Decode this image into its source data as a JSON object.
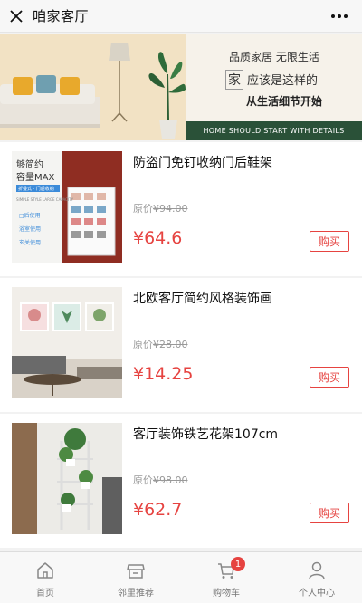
{
  "header": {
    "title": "咱家客厅",
    "close_icon": "close-icon",
    "more_icon": "more-icon"
  },
  "banner": {
    "line1": "品质家居 无限生活",
    "line2_box": "家",
    "line2_rest": "应该是这样的",
    "line3": "从生活细节开始",
    "strip": "HOME SHOULD START WITH DETAILS"
  },
  "products": [
    {
      "name": "防盗门免钉收纳门后鞋架",
      "orig_label": "原价",
      "orig_price": "¥94.00",
      "price": "¥64.6",
      "buy": "购买",
      "thumb_text": {
        "t1": "够简约",
        "t2": "容量MAX",
        "t3": "折叠式 · 门后收纳",
        "t4": "SIMPLE STYLE\nLARGE CAPACITY",
        "t5": "□后使用",
        "t6": "浴室使用",
        "t7": "玄关使用"
      }
    },
    {
      "name": "北欧客厅简约风格装饰画",
      "orig_label": "原价",
      "orig_price": "¥28.00",
      "price": "¥14.25",
      "buy": "购买"
    },
    {
      "name": "客厅装饰铁艺花架107cm",
      "orig_label": "原价",
      "orig_price": "¥98.00",
      "price": "¥62.7",
      "buy": "购买"
    }
  ],
  "tabbar": {
    "items": [
      {
        "label": "首页",
        "icon": "home-icon"
      },
      {
        "label": "邻里推荐",
        "icon": "store-icon"
      },
      {
        "label": "购物车",
        "icon": "cart-icon",
        "badge": "1"
      },
      {
        "label": "个人中心",
        "icon": "user-icon"
      }
    ]
  },
  "colors": {
    "accent": "#e64340",
    "banner_green": "#2a5138"
  }
}
